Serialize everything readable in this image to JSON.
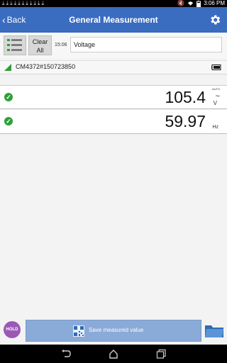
{
  "status_bar": {
    "time": "3:06 PM",
    "download_count": 11,
    "download_glyph": "⤓",
    "icons": [
      "download-icon",
      "mute-icon",
      "wifi-icon",
      "battery-icon"
    ]
  },
  "app_bar": {
    "back_label": "Back",
    "title": "General Measurement",
    "settings_icon": "gear-icon",
    "bg_color": "#3a6cc0"
  },
  "controls": {
    "clear_line1": "Clear",
    "clear_line2": "All",
    "time": "15:06",
    "mode": "Voltage"
  },
  "device": {
    "name": "CM4372#150723850"
  },
  "measurements": [
    {
      "value": "105.4",
      "range_label": "AUTO",
      "wave_glyph": "~",
      "unit": "V",
      "status": "ok"
    },
    {
      "value": "59.97",
      "unit": "Hz",
      "status": "ok"
    }
  ],
  "actions": {
    "hold_label": "HOLD",
    "save_label": "Save measured value",
    "hold_color": "#9b59b6",
    "save_color": "#8aaad8"
  },
  "nav": {
    "icons": [
      "back-nav-icon",
      "home-nav-icon",
      "recents-nav-icon"
    ]
  }
}
